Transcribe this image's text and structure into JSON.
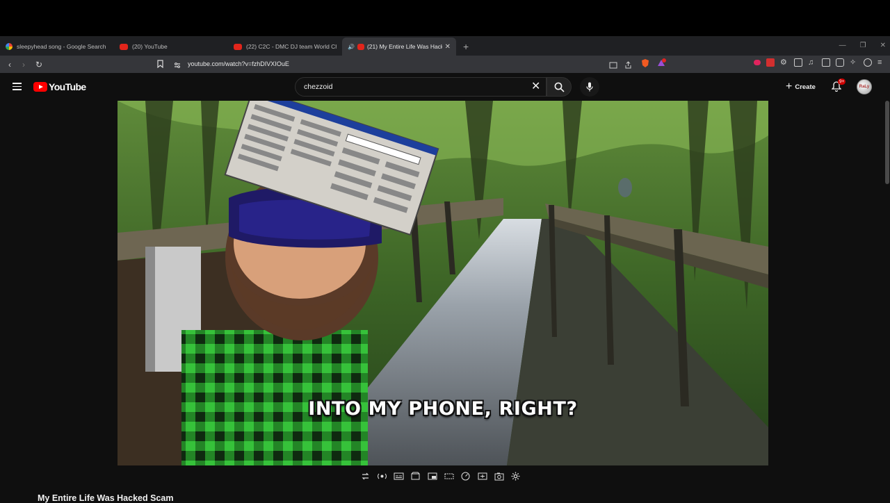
{
  "browser": {
    "tabs": [
      {
        "label": "sleepyhead song - Google Search",
        "favicon": "google-icon",
        "active": false
      },
      {
        "label": "(20) YouTube",
        "favicon": "youtube-icon",
        "active": false
      },
      {
        "label": "(22) C2C - DMC DJ team World Cham",
        "favicon": "youtube-icon",
        "active": false
      },
      {
        "label": "(21) My Entire Life Was Hack",
        "favicon": "youtube-icon",
        "active": true
      }
    ],
    "url": "youtube.com/watch?v=fzhDIVXIOuE"
  },
  "youtube": {
    "logo_text": "YouTube",
    "search_value": "chezzoid",
    "create_label": "Create",
    "notification_count": "9+",
    "avatar_text": "RaLy"
  },
  "video": {
    "caption": "INTO MY PHONE, RIGHT?",
    "title": "My Entire Life Was Hacked Scam"
  },
  "colors": {
    "youtube_red": "#ff0000",
    "background": "#0f0f0f",
    "tab_active": "#35363a"
  }
}
